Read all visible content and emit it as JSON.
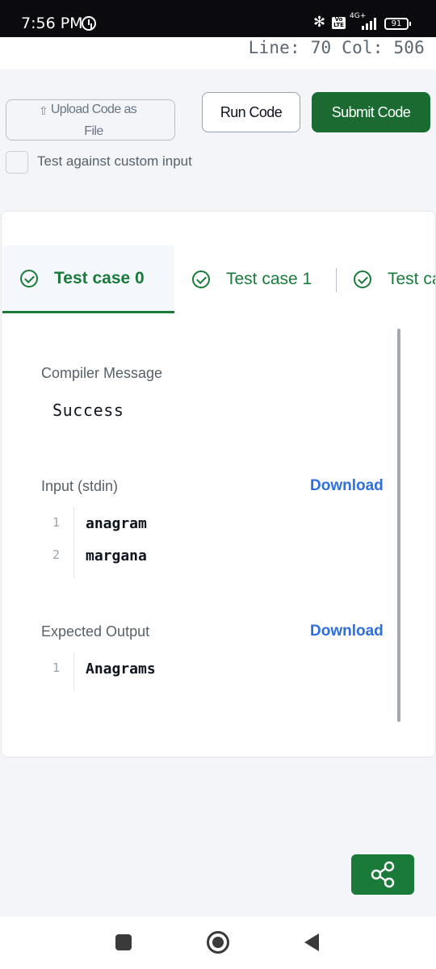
{
  "status_bar": {
    "time": "7:56 PM",
    "bluetooth_glyph": "✻",
    "volte": "Vo LTE",
    "network": "4G+",
    "battery": "91"
  },
  "editor": {
    "cursor_position": "Line: 70 Col: 506"
  },
  "actions": {
    "upload_label_line1": "Upload Code as",
    "upload_label_line2": "File",
    "run_label": "Run Code",
    "submit_label": "Submit Code",
    "custom_input_label": "Test against custom input",
    "custom_input_checked": false
  },
  "tabs": [
    {
      "label": "Test case 0",
      "active": true
    },
    {
      "label": "Test case 1",
      "active": false
    },
    {
      "label": "Test ca",
      "active": false
    }
  ],
  "results": {
    "compiler_message_label": "Compiler Message",
    "compiler_message": "Success",
    "input_label": "Input (stdin)",
    "input_download": "Download",
    "input_lines": [
      {
        "number": "1",
        "text": "anagram"
      },
      {
        "number": "2",
        "text": "margana"
      }
    ],
    "expected_label": "Expected Output",
    "expected_download": "Download",
    "expected_lines": [
      {
        "number": "1",
        "text": "Anagrams"
      }
    ]
  },
  "colors": {
    "accent_green": "#1a7a3a",
    "submit_green": "#1a6a32",
    "link_blue": "#2e6fe0"
  },
  "icons": {
    "upload": "upload-icon",
    "tab_check": "check-circle-icon",
    "share": "share-icon",
    "nav_recents": "square-icon",
    "nav_home": "circle-icon",
    "nav_back": "triangle-back-icon"
  }
}
